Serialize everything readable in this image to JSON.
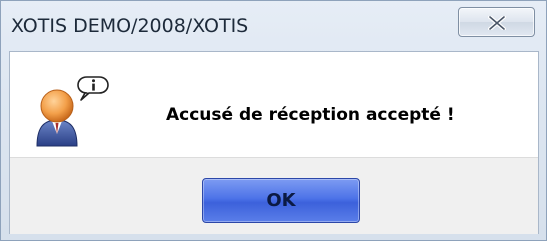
{
  "window": {
    "title": "XOTIS DEMO/2008/XOTIS",
    "close_icon": "close-icon"
  },
  "dialog": {
    "icon": "user-info-icon",
    "message": "Accusé de réception accepté !",
    "ok_label": "OK"
  },
  "colors": {
    "ok_button": "#4d73e8",
    "frame": "#dde6f1",
    "content_bg": "#ffffff",
    "button_area_bg": "#f0f0f0"
  }
}
